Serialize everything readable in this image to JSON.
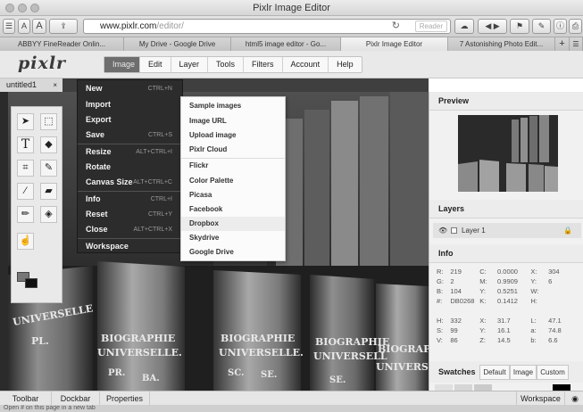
{
  "window": {
    "title": "Pixlr Image Editor"
  },
  "toolbar": {
    "url_domain": "www.pixlr.com",
    "url_path": "/editor/",
    "reader": "Reader",
    "font_small": "A",
    "font_large": "A"
  },
  "tabs": [
    "ABBYY FineReader Onlin...",
    "My Drive - Google Drive",
    "html5 image editor - Go...",
    "Pixlr Image Editor",
    "7 Astonishing Photo Edit..."
  ],
  "app": {
    "logo": "pixlr",
    "menu": [
      "Image",
      "Edit",
      "Layer",
      "Tools",
      "Filters",
      "Account",
      "Help"
    ],
    "doc_tab": "untitled1",
    "doc_tab_close": "×"
  },
  "dropdown": {
    "items": [
      {
        "label": "New",
        "shortcut": "CTRL+N"
      },
      {
        "label": "Import",
        "shortcut": ""
      },
      {
        "label": "Export",
        "shortcut": ""
      },
      {
        "label": "Save",
        "shortcut": "CTRL+S"
      },
      {
        "label": "Resize",
        "shortcut": "ALT+CTRL+I"
      },
      {
        "label": "Rotate",
        "shortcut": ""
      },
      {
        "label": "Canvas Size",
        "shortcut": "ALT+CTRL+C"
      },
      {
        "label": "Info",
        "shortcut": "CTRL+I"
      },
      {
        "label": "Reset",
        "shortcut": "CTRL+Y"
      },
      {
        "label": "Close",
        "shortcut": "ALT+CTRL+X"
      },
      {
        "label": "Workspace",
        "shortcut": ""
      }
    ]
  },
  "submenu": {
    "items": [
      "Sample images",
      "Image URL",
      "Upload image",
      "Pixlr Cloud",
      "Flickr",
      "Color Palette",
      "Picasa",
      "Facebook",
      "Dropbox",
      "Skydrive",
      "Google Drive"
    ]
  },
  "canvas": {
    "labels": [
      "UNIVERSELLE",
      "BIOGRAPHIE",
      "UNIVERSELLE.",
      "PL.",
      "PR.",
      "BA.",
      "BIOGRAPHIE",
      "UNIVERSELLE.",
      "SC.",
      "SE.",
      "BIOGRAPHIE",
      "UNIVERSELL",
      "SE.",
      "BIOGRAP",
      "UNIVERS"
    ]
  },
  "panels": {
    "preview": "Preview",
    "layers": "Layers",
    "layer_name": "Layer 1",
    "info": "Info",
    "info_rows": [
      [
        "R:",
        "219",
        "C:",
        "0.0000",
        "X:",
        "304"
      ],
      [
        "G:",
        "2",
        "M:",
        "0.9909",
        "Y:",
        "6"
      ],
      [
        "B:",
        "104",
        "Y:",
        "0.5251",
        "W:",
        ""
      ],
      [
        "#:",
        "DB0268",
        "K:",
        "0.1412",
        "H:",
        ""
      ],
      [
        "",
        "",
        "",
        "",
        "",
        ""
      ],
      [
        "H:",
        "332",
        "X:",
        "31.7",
        "L:",
        "47.1"
      ],
      [
        "S:",
        "99",
        "Y:",
        "16.1",
        "a:",
        "74.8"
      ],
      [
        "V:",
        "86",
        "Z:",
        "14.5",
        "b:",
        "6.6"
      ]
    ],
    "swatches": "Swatches",
    "swatch_tabs": [
      "Default",
      "Image",
      "Custom"
    ]
  },
  "bottom": {
    "toolbar": "Toolbar",
    "dockbar": "Dockbar",
    "properties": "Properties",
    "workspace": "Workspace"
  },
  "status": "Open # on this page in a new tab"
}
